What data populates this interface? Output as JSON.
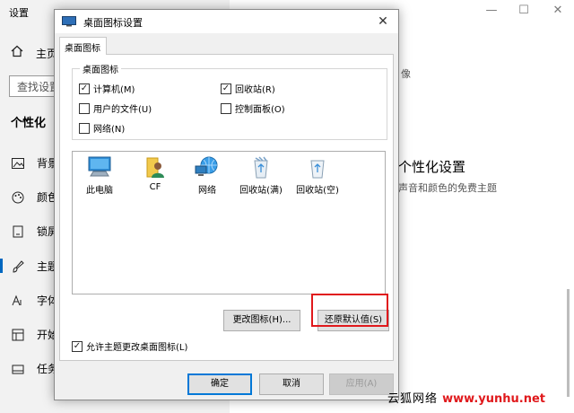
{
  "settings": {
    "title": "设置",
    "controls": {
      "minimize": "—",
      "maximize": "☐",
      "close": "✕"
    },
    "home": {
      "label": "主页",
      "icon": "home-icon"
    },
    "search_placeholder": "查找设置",
    "section_heading": "个性化",
    "nav": [
      {
        "label": "背景",
        "icon": "picture-icon"
      },
      {
        "label": "颜色",
        "icon": "palette-icon"
      },
      {
        "label": "锁屏",
        "icon": "monitor-icon"
      },
      {
        "label": "主题",
        "icon": "brush-icon"
      },
      {
        "label": "字体",
        "icon": "font-icon"
      },
      {
        "label": "开始",
        "icon": "start-icon"
      },
      {
        "label": "任务",
        "icon": "taskbar-icon"
      }
    ],
    "right": {
      "fragment": "像",
      "title": "个性化设置",
      "subtitle": "声音和颜色的免费主题"
    }
  },
  "dialog": {
    "title": "桌面图标设置",
    "close": "✕",
    "tab": "桌面图标",
    "group_label": "桌面图标",
    "checkboxes": [
      {
        "label": "计算机(M)",
        "checked": true
      },
      {
        "label": "回收站(R)",
        "checked": true
      },
      {
        "label": "用户的文件(U)",
        "checked": false
      },
      {
        "label": "控制面板(O)",
        "checked": false
      },
      {
        "label": "网络(N)",
        "checked": false
      }
    ],
    "check_mark": "✓",
    "icons": [
      {
        "label": "此电脑",
        "icon": "this-pc-icon"
      },
      {
        "label": "CF",
        "icon": "user-folder-icon"
      },
      {
        "label": "网络",
        "icon": "network-icon"
      },
      {
        "label": "回收站(满)",
        "icon": "recycle-bin-full-icon"
      },
      {
        "label": "回收站(空)",
        "icon": "recycle-bin-empty-icon"
      }
    ],
    "change_icon_button": "更改图标(H)...",
    "restore_default_button": "还原默认值(S)",
    "allow_themes": {
      "label": "允许主题更改桌面图标(L)",
      "checked": true
    },
    "ok_button": "确定",
    "cancel_button": "取消",
    "apply_button": "应用(A)"
  },
  "watermark": {
    "text": "云狐网络",
    "url": "www.yunhu.net"
  },
  "colors": {
    "accent": "#0078d7",
    "highlight": "#e0191c"
  }
}
